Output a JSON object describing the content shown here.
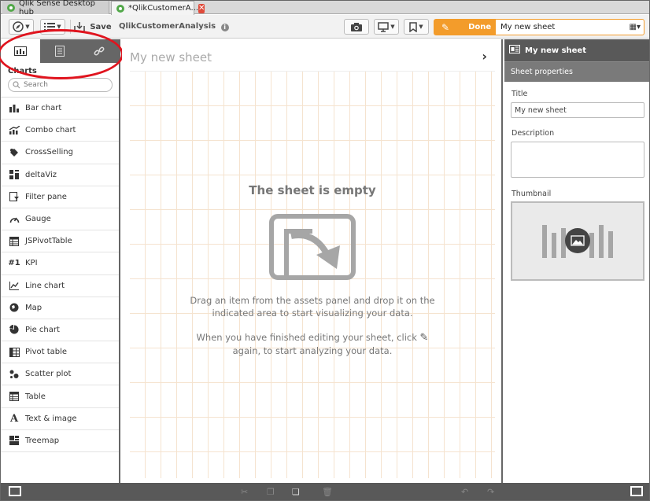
{
  "browser_tabs": [
    {
      "label": "Qlik Sense Desktop hub"
    },
    {
      "label": "*QlikCustomerA..."
    }
  ],
  "toolbar": {
    "save_label": "Save",
    "app_name": "QlikCustomerAnalysis",
    "info_symbol": "i",
    "done_label": "Done",
    "current_sheet": "My new sheet"
  },
  "left_panel": {
    "tabs": [
      "charts-tab",
      "master-items-tab",
      "fields-tab"
    ],
    "title": "Charts",
    "search_placeholder": "Search",
    "items": [
      {
        "label": "Bar chart",
        "icon": "bar-chart-icon"
      },
      {
        "label": "Combo chart",
        "icon": "combo-chart-icon"
      },
      {
        "label": "CrossSelling",
        "icon": "extension-icon"
      },
      {
        "label": "deltaViz",
        "icon": "grid-extension-icon"
      },
      {
        "label": "Filter pane",
        "icon": "filter-pane-icon"
      },
      {
        "label": "Gauge",
        "icon": "gauge-icon"
      },
      {
        "label": "JSPivotTable",
        "icon": "table-icon"
      },
      {
        "label": "KPI",
        "icon": "kpi-icon",
        "glyph": "#1"
      },
      {
        "label": "Line chart",
        "icon": "line-chart-icon"
      },
      {
        "label": "Map",
        "icon": "map-icon"
      },
      {
        "label": "Pie chart",
        "icon": "pie-chart-icon"
      },
      {
        "label": "Pivot table",
        "icon": "pivot-table-icon"
      },
      {
        "label": "Scatter plot",
        "icon": "scatter-plot-icon"
      },
      {
        "label": "Table",
        "icon": "table-icon"
      },
      {
        "label": "Text & image",
        "icon": "text-image-icon",
        "glyph": "A"
      },
      {
        "label": "Treemap",
        "icon": "treemap-icon"
      }
    ]
  },
  "canvas": {
    "sheet_title": "My new sheet",
    "empty_title": "The sheet is empty",
    "empty_msg_1": "Drag an item from the assets panel and drop it on the indicated area to start visualizing your data.",
    "empty_msg_2_a": "When you have finished editing your sheet, click",
    "empty_msg_2_b": "again, to start analyzing your data."
  },
  "right_panel": {
    "header": "My new sheet",
    "subheader": "Sheet properties",
    "title_label": "Title",
    "title_value": "My new sheet",
    "description_label": "Description",
    "description_value": "",
    "thumbnail_label": "Thumbnail"
  },
  "colors": {
    "accent_orange": "#f39c2b",
    "annotation_red": "#e0141e",
    "panel_dark": "#595959",
    "grid_line": "#f5e3cf"
  }
}
